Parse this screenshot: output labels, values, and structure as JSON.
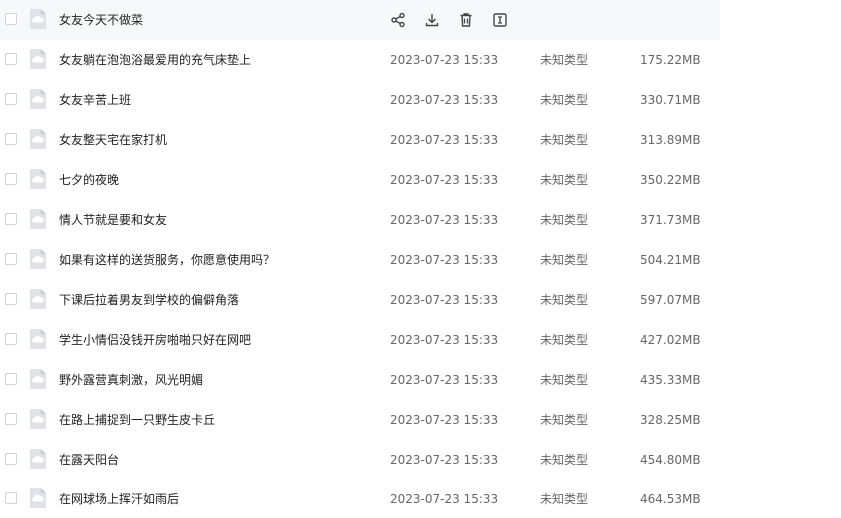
{
  "rows": [
    {
      "name": "女友今天不做菜",
      "date": "",
      "type": "",
      "size": "",
      "hovered": true
    },
    {
      "name": "女友躺在泡泡浴最爱用的充气床垫上",
      "date": "2023-07-23 15:33",
      "type": "未知类型",
      "size": "175.22MB"
    },
    {
      "name": "女友辛苦上班",
      "date": "2023-07-23 15:33",
      "type": "未知类型",
      "size": "330.71MB"
    },
    {
      "name": "女友整天宅在家打机",
      "date": "2023-07-23 15:33",
      "type": "未知类型",
      "size": "313.89MB"
    },
    {
      "name": "七夕的夜晚",
      "date": "2023-07-23 15:33",
      "type": "未知类型",
      "size": "350.22MB"
    },
    {
      "name": "情人节就是要和女友",
      "date": "2023-07-23 15:33",
      "type": "未知类型",
      "size": "371.73MB"
    },
    {
      "name": "如果有这样的送货服务，你愿意使用吗？",
      "date": "2023-07-23 15:33",
      "type": "未知类型",
      "size": "504.21MB"
    },
    {
      "name": "下课后拉着男友到学校的偏僻角落",
      "date": "2023-07-23 15:33",
      "type": "未知类型",
      "size": "597.07MB"
    },
    {
      "name": "学生小情侣没钱开房啪啪只好在网吧",
      "date": "2023-07-23 15:33",
      "type": "未知类型",
      "size": "427.02MB"
    },
    {
      "name": "野外露营真刺激，风光明媚",
      "date": "2023-07-23 15:33",
      "type": "未知类型",
      "size": "435.33MB"
    },
    {
      "name": "在路上捕捉到一只野生皮卡丘",
      "date": "2023-07-23 15:33",
      "type": "未知类型",
      "size": "328.25MB"
    },
    {
      "name": "在露天阳台",
      "date": "2023-07-23 15:33",
      "type": "未知类型",
      "size": "454.80MB"
    },
    {
      "name": "在网球场上挥汗如雨后",
      "date": "2023-07-23 15:33",
      "type": "未知类型",
      "size": "464.53MB"
    }
  ],
  "hover_actions": [
    {
      "icon": "share-icon"
    },
    {
      "icon": "download-icon"
    },
    {
      "icon": "trash-icon"
    },
    {
      "icon": "rename-icon"
    }
  ],
  "colors": {
    "hover_bg": "#f7f8fa",
    "icon": "#555555",
    "file_icon": "#c8ccd2"
  }
}
